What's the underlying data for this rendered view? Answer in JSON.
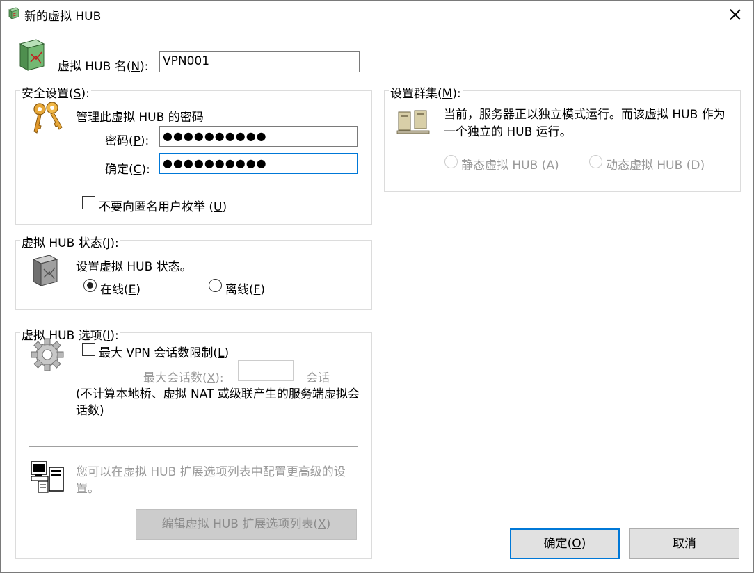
{
  "window": {
    "title": "新的虚拟 HUB"
  },
  "hub_name": {
    "label": "虚拟 HUB 名",
    "accel": "N",
    "value": "VPN001"
  },
  "security": {
    "title": "安全设置",
    "accel": "S",
    "heading": "管理此虚拟 HUB 的密码",
    "password_label": "密码",
    "password_accel": "P",
    "password_value": "●●●●●●●●●●",
    "confirm_label": "确定",
    "confirm_accel": "C",
    "confirm_value": "●●●●●●●●●●",
    "no_enum_label": "不要向匿名用户枚举 ",
    "no_enum_accel": "U"
  },
  "cluster": {
    "title": "设置群集",
    "accel": "M",
    "text": "当前，服务器正以独立模式运行。而该虚拟 HUB 作为一个独立的 HUB 运行。",
    "static_label": "静态虚拟 HUB ",
    "static_accel": "A",
    "dynamic_label": "动态虚拟 HUB ",
    "dynamic_accel": "D"
  },
  "status": {
    "title": "虚拟 HUB 状态",
    "accel": "J",
    "heading": "设置虚拟 HUB 状态。",
    "online_label": "在线",
    "online_accel": "E",
    "offline_label": "离线",
    "offline_accel": "F"
  },
  "options": {
    "title": "虚拟 HUB 选项",
    "accel": "I",
    "max_sessions_label": "最大 VPN 会话数限制",
    "max_sessions_accel": "L",
    "max_count_label": "最大会话数",
    "max_count_accel": "X",
    "max_count_value": "",
    "sessions_unit": "会话",
    "note": "(不计算本地桥、虚拟 NAT 或级联产生的服务端虚拟会话数)",
    "ext_text": "您可以在虚拟 HUB 扩展选项列表中配置更高级的设置。",
    "ext_button_label": "编辑虚拟 HUB 扩展选项列表",
    "ext_button_accel": "X"
  },
  "buttons": {
    "ok_label": "确定",
    "ok_accel": "O",
    "cancel_label": "取消"
  }
}
